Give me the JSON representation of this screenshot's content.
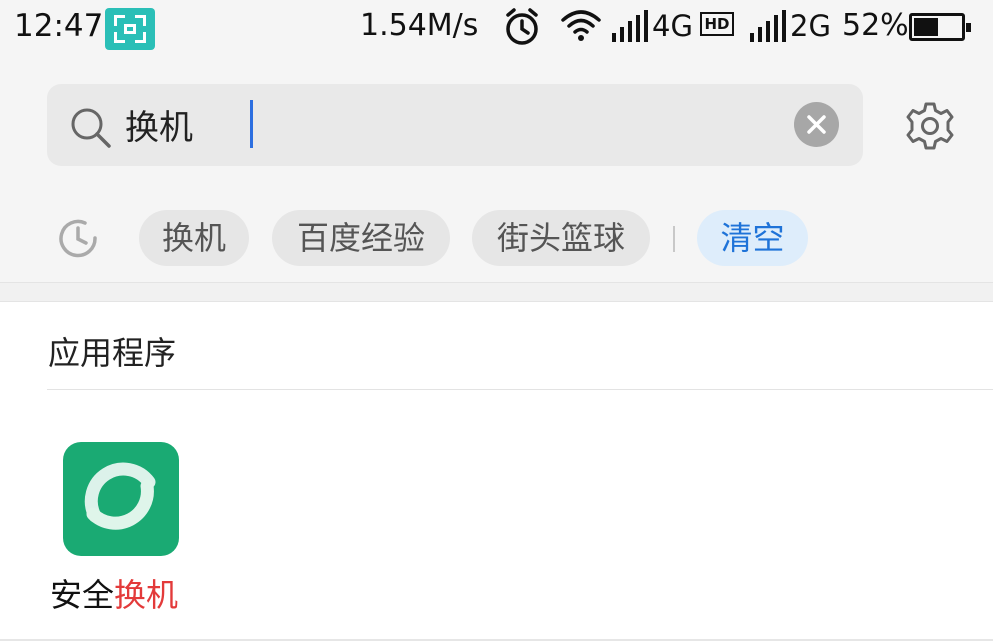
{
  "status_bar": {
    "time": "12:47",
    "speed": "1.54M/s",
    "network1": "4G",
    "hd": "HD",
    "network2": "2G",
    "battery": "52%",
    "battery_level": 0.52
  },
  "search": {
    "query": "换机",
    "clear_icon": "close-icon",
    "search_icon": "magnifier-icon",
    "settings_icon": "gear-icon"
  },
  "history": {
    "icon": "history-clock-icon",
    "items": [
      "换机",
      "百度经验",
      "街头篮球"
    ],
    "clear_label": "清空"
  },
  "results": {
    "section_title": "应用程序",
    "apps": [
      {
        "name_prefix": "安全",
        "name_highlight": "换机",
        "icon": "app-switch-icon"
      }
    ]
  },
  "colors": {
    "accent": "#1f73d8",
    "highlight": "#e33a3a",
    "app_green": "#1aaa73",
    "scan_teal": "#2bbfb7"
  }
}
